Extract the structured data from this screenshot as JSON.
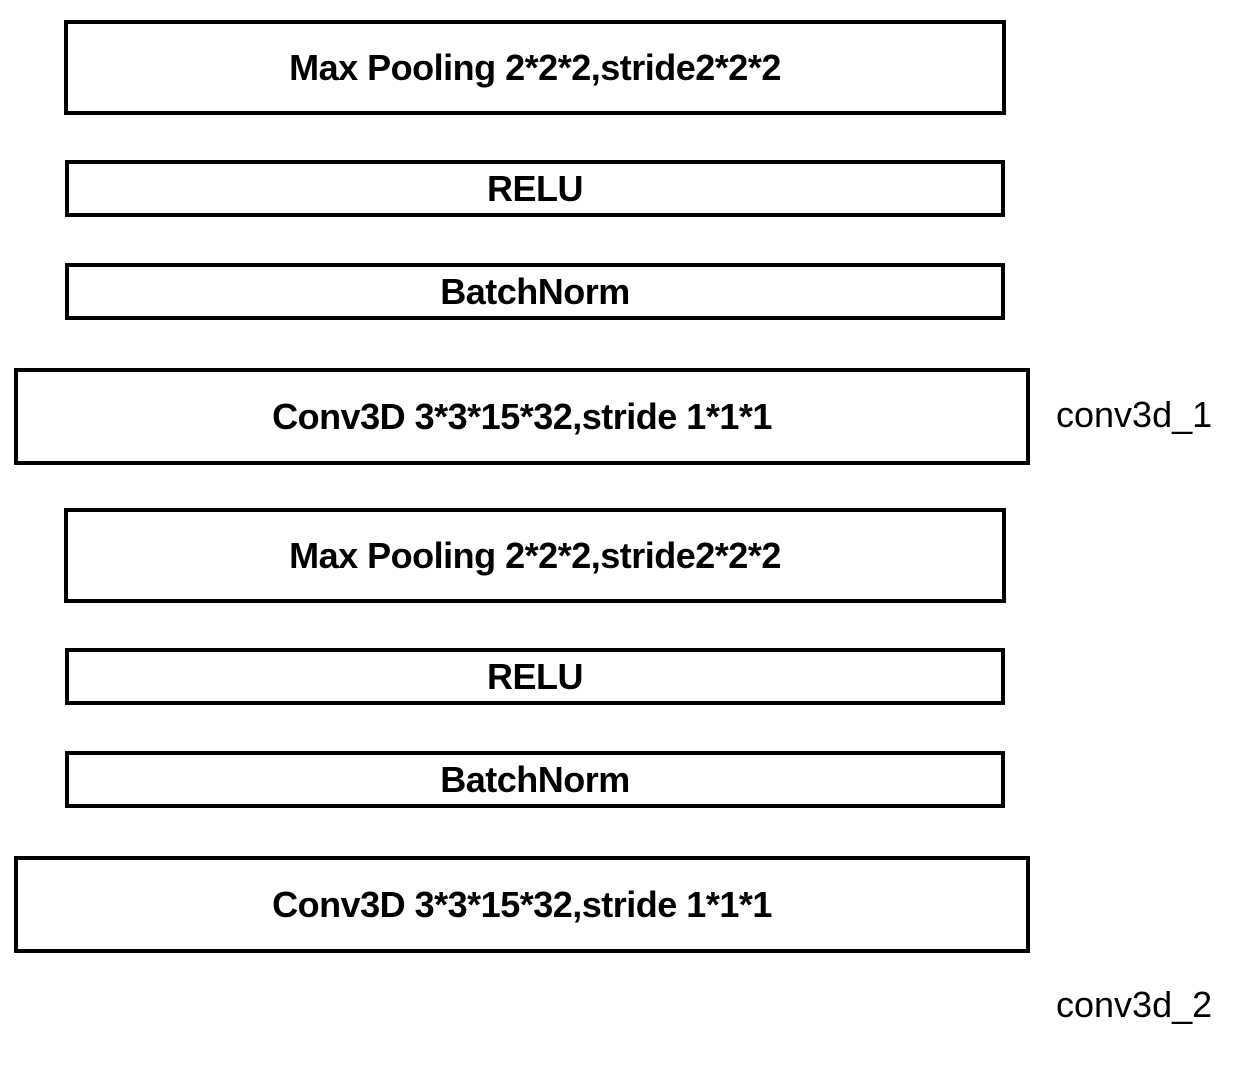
{
  "layers": {
    "l0": "Max Pooling 2*2*2,stride2*2*2",
    "l1": "RELU",
    "l2": "BatchNorm",
    "l3": "Conv3D 3*3*15*32,stride 1*1*1",
    "l4": "Max Pooling 2*2*2,stride2*2*2",
    "l5": "RELU",
    "l6": "BatchNorm",
    "l7": "Conv3D 3*3*15*32,stride 1*1*1"
  },
  "side_labels": {
    "s1": "conv3d_1",
    "s2": "conv3d_2"
  }
}
